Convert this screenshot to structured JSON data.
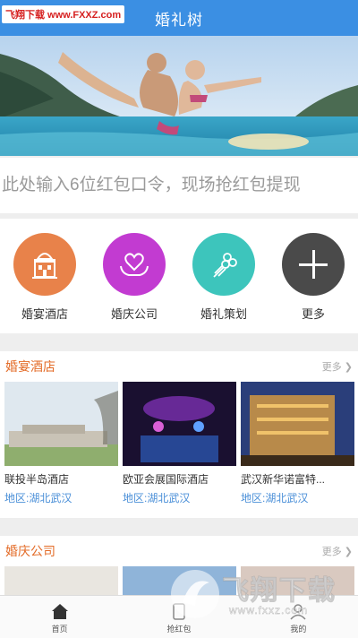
{
  "header": {
    "title": "婚礼树"
  },
  "watermark_top": "飞翔下载 www.FXXZ.com",
  "redpacket": {
    "placeholder": "此处输入6位红包口令，现场抢红包提现"
  },
  "categories": [
    {
      "label": "婚宴酒店",
      "icon": "hotel-building-icon",
      "color": "#e8824a"
    },
    {
      "label": "婚庆公司",
      "icon": "heart-hands-icon",
      "color": "#c23bd1"
    },
    {
      "label": "婚礼策划",
      "icon": "flower-bouquet-icon",
      "color": "#3dc5bc"
    },
    {
      "label": "更多",
      "icon": "plus-icon",
      "color": "#4a4a4a"
    }
  ],
  "sections": {
    "hotels": {
      "title": "婚宴酒店",
      "more": "更多",
      "items": [
        {
          "name": "联投半岛酒店",
          "area": "地区:湖北武汉"
        },
        {
          "name": "欧亚会展国际酒店",
          "area": "地区:湖北武汉"
        },
        {
          "name": "武汉新华诺富特...",
          "area": "地区:湖北武汉"
        }
      ]
    },
    "companies": {
      "title": "婚庆公司",
      "more": "更多"
    }
  },
  "tabbar": [
    {
      "label": "首页",
      "icon": "home-icon",
      "active": true
    },
    {
      "label": "抢红包",
      "icon": "redpacket-icon",
      "active": false
    },
    {
      "label": "我的",
      "icon": "user-icon",
      "active": false
    }
  ],
  "watermark_bottom": {
    "brand": "飞翔下载",
    "url": "www.fxxz.com"
  },
  "colors": {
    "header": "#3b8fe3",
    "section_title": "#e36b27",
    "area_text": "#4a8fd8"
  }
}
